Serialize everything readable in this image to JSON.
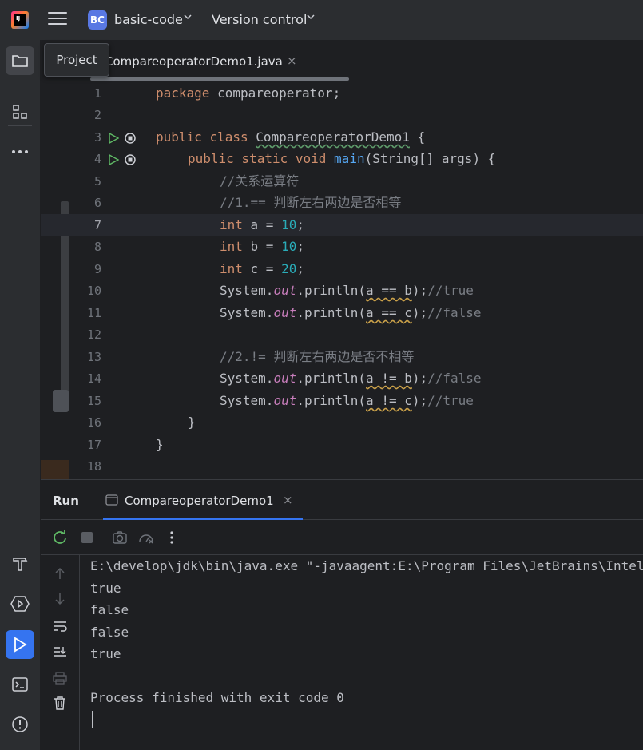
{
  "titlebar": {
    "logo_text": "IJ",
    "project_badge": "BC",
    "project_name": "basic-code",
    "vcs_label": "Version control"
  },
  "tooltip": {
    "text": "Project"
  },
  "editor_tab": {
    "label": "CompareoperatorDemo1.java",
    "close": "×"
  },
  "code": {
    "lines": [
      "1",
      "2",
      "3",
      "4",
      "5",
      "6",
      "7",
      "8",
      "9",
      "10",
      "11",
      "12",
      "13",
      "14",
      "15",
      "16",
      "17",
      "18"
    ],
    "current_line": 7,
    "package_kw": "package",
    "package_name": " compareoperator;",
    "public_kw": "public",
    "class_kw": "class",
    "class_name": "CompareoperatorDemo1",
    "brace_open": " {",
    "static_kw": "static",
    "void_kw": "void",
    "main_fn": "main",
    "main_params": "(String[] args) {",
    "comment_1": "//关系运算符",
    "comment_2": "//1.== 判断左右两边是否相等",
    "int_kw": "int",
    "decl_a": " a = ",
    "decl_b": " b = ",
    "decl_c": " c = ",
    "val_a": "10",
    "val_b": "10",
    "val_c": "20",
    "semicolon": ";",
    "system": "System.",
    "out": "out",
    "println": ".println(",
    "expr_a_eq_b": "a == b",
    "expr_a_eq_c": "a == c",
    "expr_a_ne_b": "a != b",
    "expr_a_ne_c": "a != c",
    "close_paren": ");",
    "cm_true": "//true",
    "cm_false": "//false",
    "comment_3": "//2.!= 判断左右两边是否不相等",
    "close_brace": "}"
  },
  "run_panel": {
    "title": "Run",
    "tab_label": "CompareoperatorDemo1",
    "tab_close": "×",
    "console_lines": [
      "E:\\develop\\jdk\\bin\\java.exe \"-javaagent:E:\\Program Files\\JetBrains\\IntelliJ",
      "true",
      "false",
      "false",
      "true",
      "",
      "Process finished with exit code 0"
    ]
  },
  "colors": {
    "accent": "#3574f0",
    "keyword": "#cf8e6d",
    "number": "#2aacb8",
    "comment": "#7a7e85",
    "field": "#c77dbb",
    "function": "#56a8f5"
  },
  "icons": [
    "hamburger-icon",
    "folder-icon",
    "structure-icon",
    "more-icon",
    "build-icon",
    "services-icon",
    "run-icon",
    "terminal-icon",
    "problems-icon",
    "rerun-icon",
    "stop-icon",
    "camera-icon",
    "gauge-icon",
    "kebab-icon",
    "up-arrow-icon",
    "down-arrow-icon",
    "soft-wrap-icon",
    "scroll-end-icon",
    "print-icon",
    "trash-icon"
  ]
}
